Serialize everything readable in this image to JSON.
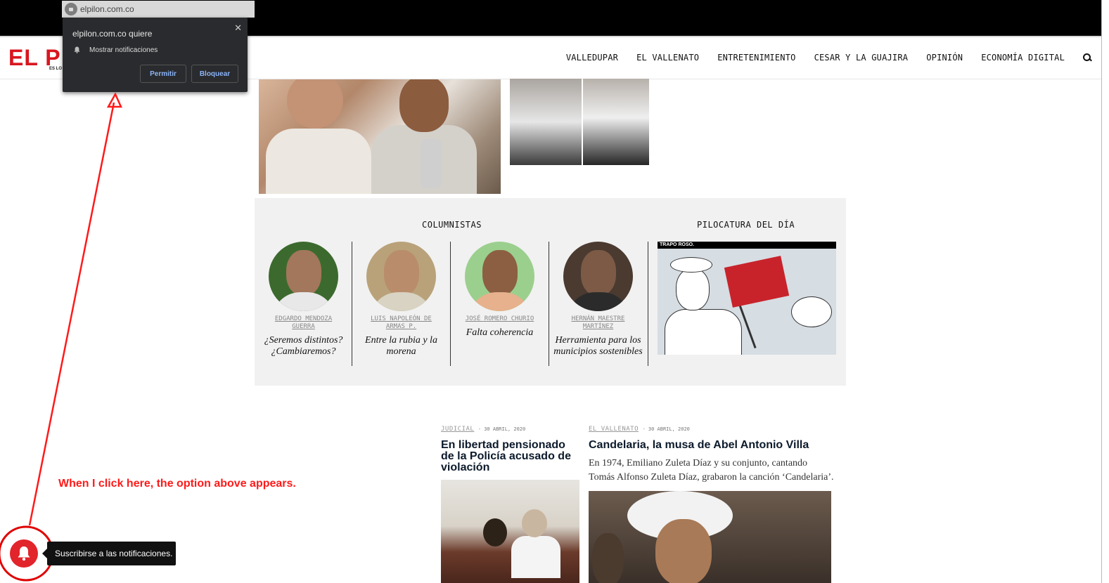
{
  "browser": {
    "url": "elpilon.com.co"
  },
  "notification_popup": {
    "title": "elpilon.com.co quiere",
    "permission": "Mostrar notificaciones",
    "allow_label": "Permitir",
    "block_label": "Bloquear",
    "close_label": "✕"
  },
  "header": {
    "logo": "EL P",
    "tagline": "ES LO",
    "nav": [
      "VALLEDUPAR",
      "EL VALLENATO",
      "ENTRETENIMIENTO",
      "CESAR Y LA GUAJIRA",
      "OPINIÓN",
      "ECONOMÍA DIGITAL"
    ]
  },
  "columnists": {
    "heading": "COLUMNISTAS",
    "items": [
      {
        "name": "EDGARDO MENDOZA GUERRA",
        "title": "¿Seremos distintos? ¿Cambiaremos?"
      },
      {
        "name": "LUIS NAPOLEÓN DE ARMAS P.",
        "title": "Entre la rubia y la morena"
      },
      {
        "name": "JOSÉ ROMERO CHURIO",
        "title": "Falta coherencia"
      },
      {
        "name": "HERNÁN MAESTRE MARTÍNEZ",
        "title": "Herramienta para los municipios sostenibles"
      }
    ]
  },
  "pilocatura": {
    "heading": "PILOCATURA DEL DÍA",
    "strip_label": "TRAPO ROSO."
  },
  "news": [
    {
      "category": "JUDICIAL",
      "date": "30 ABRIL, 2020",
      "title": "En libertad pensionado de la Policía acusado de violación",
      "desc": ""
    },
    {
      "category": "EL VALLENATO",
      "date": "30 ABRIL, 2020",
      "title": "Candelaria, la musa de Abel Antonio Villa",
      "desc": "En 1974, Emiliano Zuleta Díaz y su conjunto, cantando Tomás Alfonso Zuleta Díaz, grabaron la canción ‘Candelaria’."
    }
  ],
  "annotation": "When I click here, the option above appears.",
  "subscribe_tooltip": "Suscribirse a las notificaciones.",
  "colors": {
    "brand_red": "#d9161f",
    "annotation_red": "#ff1a1a",
    "popup_bg": "#2a2b2e",
    "link_blue": "#8ab4f8"
  }
}
